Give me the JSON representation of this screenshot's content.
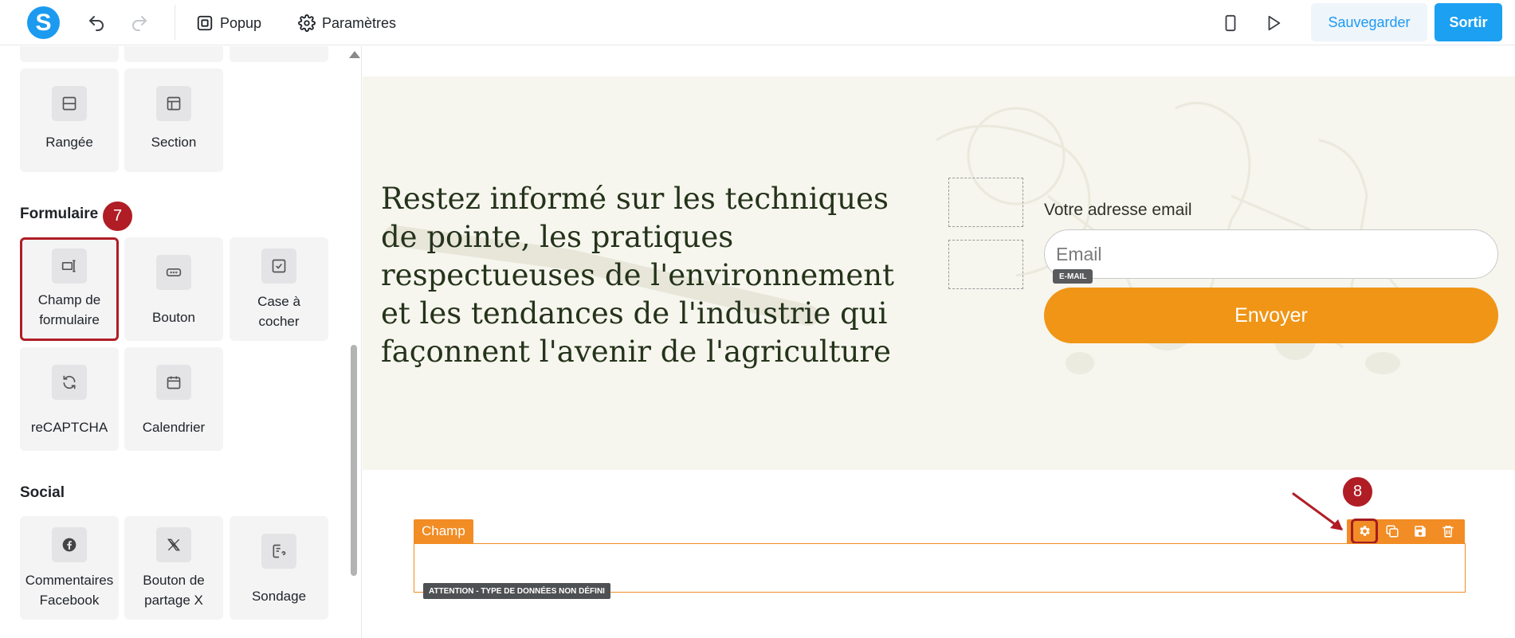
{
  "topbar": {
    "logo": "S",
    "popup_label": "Popup",
    "settings_label": "Paramètres",
    "save_label": "Sauvegarder",
    "exit_label": "Sortir"
  },
  "panel": {
    "layout_tiles": [
      {
        "label": "Rangée",
        "icon": "row-icon"
      },
      {
        "label": "Section",
        "icon": "section-icon"
      }
    ],
    "form_section_title": "Formulaire",
    "form_tiles": [
      {
        "label": "Champ de formulaire",
        "icon": "form-field-icon",
        "highlighted": true
      },
      {
        "label": "Bouton",
        "icon": "button-icon"
      },
      {
        "label": "Case à cocher",
        "icon": "checkbox-icon"
      },
      {
        "label": "reCAPTCHA",
        "icon": "recaptcha-icon"
      },
      {
        "label": "Calendrier",
        "icon": "calendar-icon"
      }
    ],
    "social_section_title": "Social",
    "social_tiles": [
      {
        "label": "Commentaires Facebook",
        "icon": "facebook-icon"
      },
      {
        "label": "Bouton de partage X",
        "icon": "x-icon"
      },
      {
        "label": "Sondage",
        "icon": "survey-icon"
      }
    ],
    "step_badge": "7"
  },
  "canvas": {
    "headline": "Restez informé sur les techniques de pointe, les pratiques respectueuses de l'environnement et les tendances de l'industrie qui façonnent l'avenir de l'agriculture",
    "email_label": "Votre adresse email",
    "email_placeholder": "Email",
    "email_tag": "E-MAIL",
    "send_label": "Envoyer",
    "field_tab": "Champ",
    "warning_tag": "ATTENTION - TYPE DE DONNÉES NON DÉFINI",
    "step_badge": "8"
  },
  "colors": {
    "brand_blue": "#1ba0f2",
    "accent_orange": "#f28c24",
    "badge_red": "#b01d25",
    "hero_bg": "#f6f5ee"
  }
}
